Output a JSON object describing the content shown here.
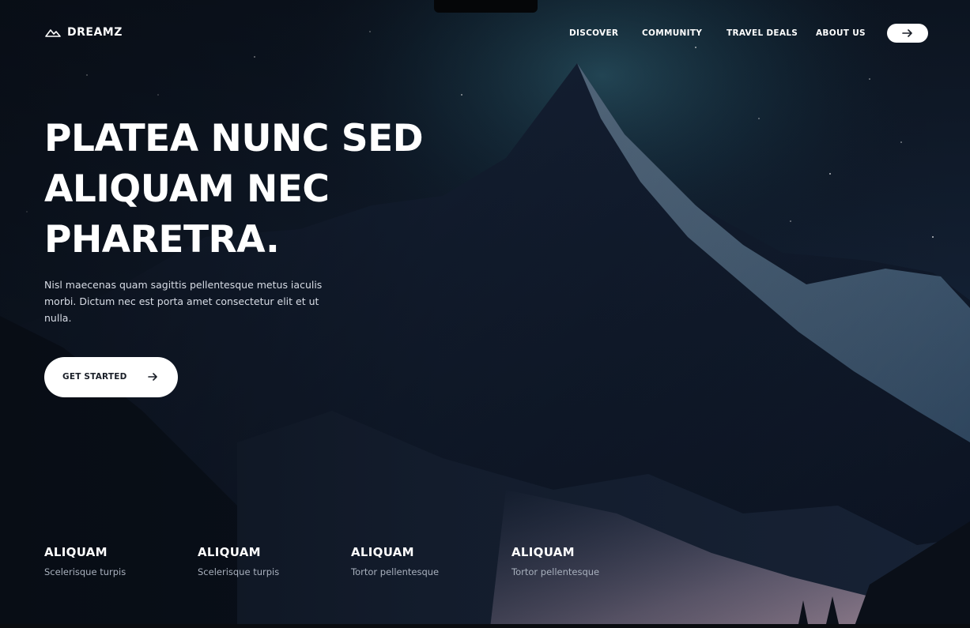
{
  "brand": {
    "name": "DREAMZ",
    "icon": "mountain-logo-icon"
  },
  "nav": {
    "links": [
      {
        "label": "DISCOVER"
      },
      {
        "label": "COMMUNITY"
      },
      {
        "label": "TRAVEL DEALS"
      },
      {
        "label": "ABOUT US"
      }
    ],
    "cta_icon": "arrow-right-icon"
  },
  "hero": {
    "headline": [
      "PLATEA NUNC SED",
      "ALIQUAM NEC",
      "PHARETRA."
    ],
    "lead": "Nisl maecenas quam sagittis pellentesque metus iaculis morbi. Dictum nec est porta amet consectetur elit et ut nulla.",
    "cta_label": "GET STARTED",
    "cta_icon": "arrow-right-icon"
  },
  "features": [
    {
      "title": "ALIQUAM",
      "subtitle": "Scelerisque turpis"
    },
    {
      "title": "ALIQUAM",
      "subtitle": "Scelerisque turpis"
    },
    {
      "title": "ALIQUAM",
      "subtitle": "Tortor pellentesque"
    },
    {
      "title": "ALIQUAM",
      "subtitle": "Tortor pellentesque"
    }
  ],
  "colors": {
    "background": "#0d1420",
    "text": "#ffffff",
    "button_bg": "#ffffff",
    "button_text": "#1a1f28",
    "muted_text": "#a8b0bd"
  }
}
